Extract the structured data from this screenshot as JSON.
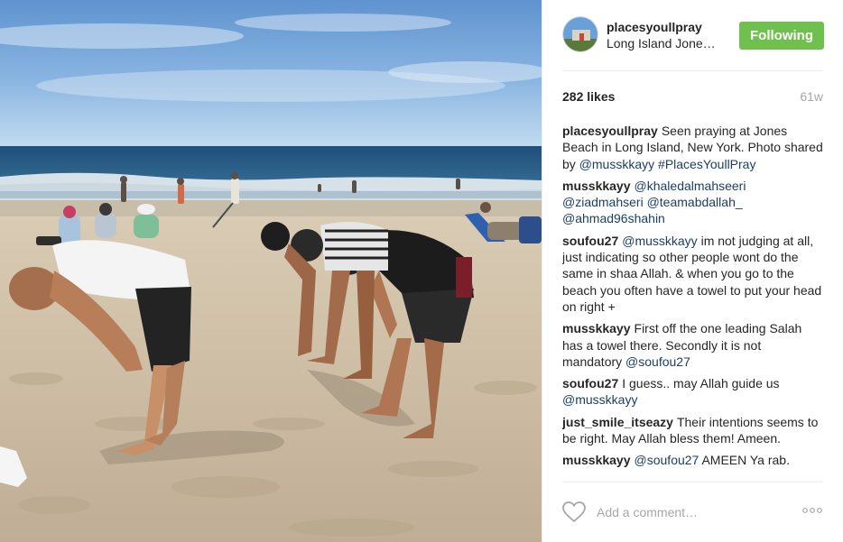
{
  "post": {
    "username": "placesyoullpray",
    "location": "Long Island Jone…",
    "follow_label": "Following",
    "likes": "282 likes",
    "age": "61w"
  },
  "comments": [
    {
      "user": "placesyoullpray",
      "text_parts": [
        {
          "t": "Seen praying at Jones Beach in Long Island, New York. Photo shared by "
        },
        {
          "t": "@musskkayy",
          "link": true
        },
        {
          "t": " "
        },
        {
          "t": "#PlacesYoullPray",
          "link": true
        }
      ]
    },
    {
      "user": "musskkayy",
      "text_parts": [
        {
          "t": "@khaledalmahseeri",
          "link": true
        },
        {
          "t": " "
        },
        {
          "t": "@ziadmahseri",
          "link": true
        },
        {
          "t": " "
        },
        {
          "t": "@teamabdallah_",
          "link": true
        },
        {
          "t": " "
        },
        {
          "t": "@ahmad96shahin",
          "link": true
        }
      ]
    },
    {
      "user": "soufou27",
      "text_parts": [
        {
          "t": "@musskkayy",
          "link": true
        },
        {
          "t": " im not judging at all, just indicating so other people wont do the same in shaa Allah. & when you go to the beach you often have a towel to put your head on right +"
        }
      ]
    },
    {
      "user": "musskkayy",
      "text_parts": [
        {
          "t": "First off the one leading Salah has a towel there. Secondly it is not mandatory "
        },
        {
          "t": "@soufou27",
          "link": true
        }
      ]
    },
    {
      "user": "soufou27",
      "text_parts": [
        {
          "t": "I guess.. may Allah guide us "
        },
        {
          "t": "@musskkayy",
          "link": true
        }
      ]
    },
    {
      "user": "just_smile_itseazy",
      "text_parts": [
        {
          "t": "Their intentions seems to be right. May Allah bless them! Ameen."
        }
      ]
    },
    {
      "user": "musskkayy",
      "text_parts": [
        {
          "t": "@soufou27",
          "link": true
        },
        {
          "t": " AMEEN Ya rab."
        }
      ]
    },
    {
      "user": "",
      "text_parts": []
    }
  ],
  "footer": {
    "comment_placeholder": "Add a comment…",
    "heart_icon": "heart-outline-icon",
    "more_icon": "more-options-icon"
  },
  "colors": {
    "follow_green": "#70c050",
    "link_blue": "#1b3f62",
    "muted_gray": "#a5a7aa"
  }
}
